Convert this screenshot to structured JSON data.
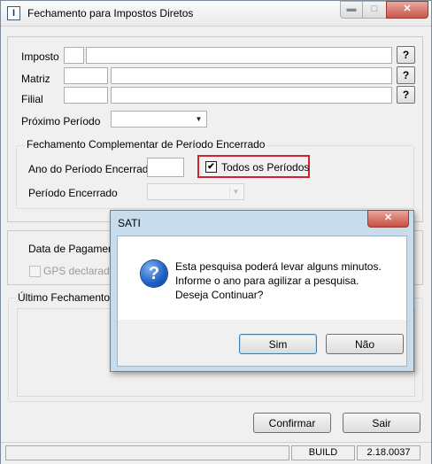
{
  "window": {
    "title": "Fechamento para Impostos Diretos",
    "icon": "app-icon",
    "icon_glyph": "I",
    "minimize_glyph": "▬",
    "maximize_glyph": "□",
    "close_glyph": "✕"
  },
  "form": {
    "imposto_label": "Imposto",
    "matriz_label": "Matriz",
    "filial_label": "Filial",
    "proximo_periodo_label": "Próximo Período",
    "lookup_button": "?",
    "imposto_code": "",
    "imposto_desc": "",
    "matriz_code": "",
    "matriz_desc": "",
    "filial_code": "",
    "filial_desc": "",
    "proximo_periodo_value": ""
  },
  "complementar_group": {
    "title": "Fechamento Complementar de Período Encerrado",
    "ano_label": "Ano do Período Encerrado",
    "ano_value": "",
    "todos_checkbox_label": "Todos os Períodos",
    "todos_checked": true,
    "check_glyph": "✔",
    "periodo_label": "Período Encerrado",
    "periodo_value": ""
  },
  "pagamento": {
    "data_label": "Data de Pagamento",
    "gps_label": "GPS declarada",
    "gps_checked": false
  },
  "ultimo_group": {
    "title": "Último Fechamento Ef"
  },
  "buttons": {
    "confirmar": "Confirmar",
    "sair": "Sair"
  },
  "status": {
    "build_label": "BUILD",
    "version": "2.18.0037"
  },
  "dialog": {
    "title": "SATI",
    "close_glyph": "✕",
    "icon": "question-icon",
    "icon_glyph": "?",
    "message_lines": [
      "Esta pesquisa poderá levar alguns minutos.",
      "Informe o ano para agilizar a pesquisa.",
      "Deseja Continuar?"
    ],
    "yes_button": "Sim",
    "no_button": "Não"
  },
  "colors": {
    "highlight": "#d2202f",
    "dialog_frame": "#c9dcec",
    "window_bg": "#f0f0f0"
  }
}
